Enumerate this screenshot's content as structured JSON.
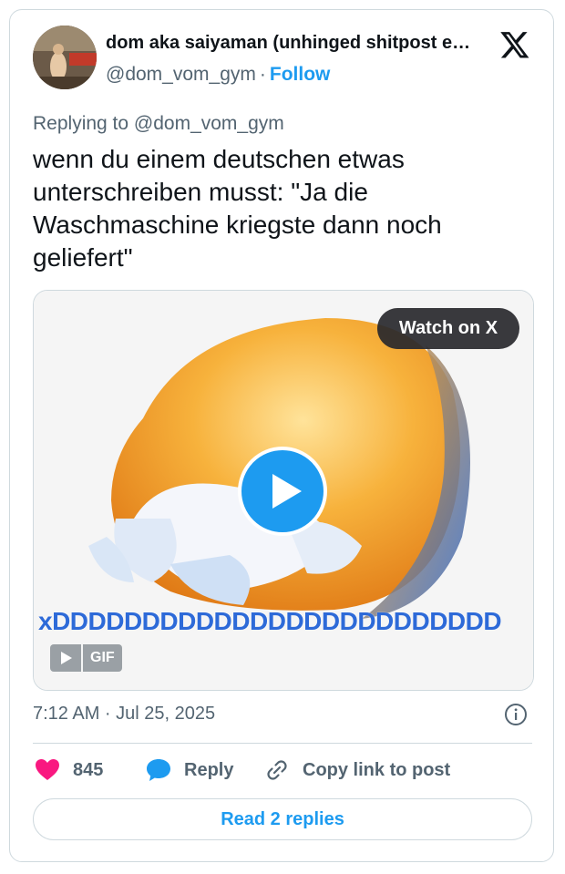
{
  "author": {
    "name": "dom aka saiyaman (unhinged shitpost e…",
    "handle": "@dom_vom_gym",
    "separator": "·",
    "follow_label": "Follow"
  },
  "replying_to": "Replying to @dom_vom_gym",
  "tweet_text": "wenn du einem deutschen etwas\nunterschreiben musst: \"Ja die\nWaschmaschine kriegste dann noch\ngeliefert\"",
  "media": {
    "watch_label": "Watch on X",
    "caption_text": "xDDDDDDDDDDDDDDDDDDDDDDDDD",
    "gif_badge": "GIF"
  },
  "timestamp": "7:12 AM · Jul 25, 2025",
  "actions": {
    "like_count": "845",
    "reply_label": "Reply",
    "copy_link_label": "Copy link to post"
  },
  "read_replies_label": "Read 2 replies",
  "colors": {
    "accent": "#1d9bf0",
    "heart": "#f91880",
    "reply_bubble": "#1d9bf0"
  }
}
